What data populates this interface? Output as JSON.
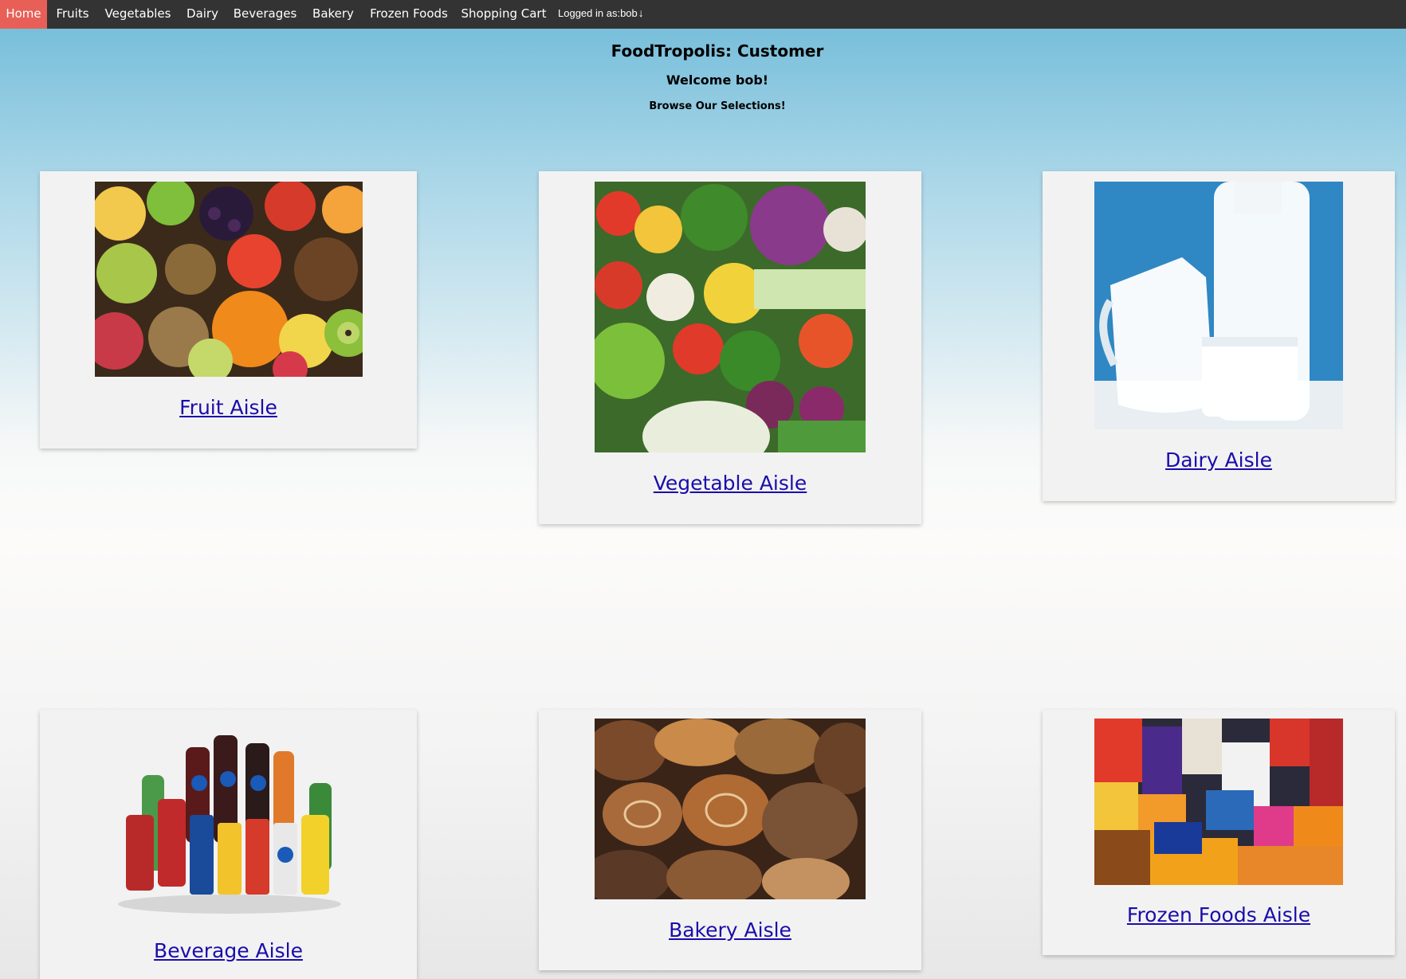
{
  "nav": {
    "items": [
      {
        "label": "Home",
        "active": true
      },
      {
        "label": "Fruits"
      },
      {
        "label": "Vegetables"
      },
      {
        "label": "Dairy"
      },
      {
        "label": "Beverages"
      },
      {
        "label": "Bakery"
      },
      {
        "label": "Frozen Foods"
      },
      {
        "label": "Shopping Cart"
      }
    ],
    "user_label": "Logged in as:bob",
    "user_icon": "down-arrow-icon",
    "bar_color": "#333333",
    "active_color": "#e85f57"
  },
  "header": {
    "title": "FoodTropolis: Customer",
    "welcome": "Welcome bob!",
    "subtitle": "Browse Our Selections!"
  },
  "aisles": [
    {
      "label": "Fruit Aisle",
      "image": "fruit-assortment"
    },
    {
      "label": "Vegetable Aisle",
      "image": "vegetable-assortment"
    },
    {
      "label": "Dairy Aisle",
      "image": "milk-jug-and-bottle"
    },
    {
      "label": "Beverage Aisle",
      "image": "soda-bottles-and-cans"
    },
    {
      "label": "Bakery Aisle",
      "image": "bread-and-pastries"
    },
    {
      "label": "Frozen Foods Aisle",
      "image": "frozen-food-packages"
    }
  ],
  "colors": {
    "link": "#1a0dab",
    "card": "#f2f2f2"
  }
}
